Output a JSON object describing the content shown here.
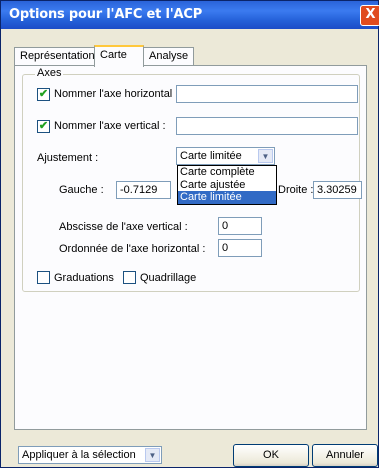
{
  "window": {
    "title": "Options pour l'AFC et l'ACP",
    "close_glyph": "X"
  },
  "tabs": [
    {
      "label": "Représentation",
      "active": false
    },
    {
      "label": "Carte",
      "active": true
    },
    {
      "label": "Analyse",
      "active": false
    }
  ],
  "axes": {
    "group_label": "Axes",
    "horizontal": {
      "checked": true,
      "label": "Nommer l'axe horizontal :",
      "value": ""
    },
    "vertical": {
      "checked": true,
      "label": "Nommer l'axe vertical :",
      "value": ""
    },
    "adjustment": {
      "label": "Ajustement :",
      "selected": "Carte limitée",
      "options": [
        "Carte complète",
        "Carte ajustée",
        "Carte limitée"
      ],
      "highlighted_option": "Carte limitée"
    },
    "left": {
      "label": "Gauche :",
      "value": "-0.7129"
    },
    "right": {
      "label": "Droite :",
      "value": "3.30259"
    },
    "vertical_axis_abscissa": {
      "label": "Abscisse de l'axe vertical :",
      "value": "0"
    },
    "horizontal_axis_ordinate": {
      "label": "Ordonnée de l'axe horizontal :",
      "value": "0"
    }
  },
  "options": {
    "graduations": {
      "checked": false,
      "label": "Graduations"
    },
    "gridlines": {
      "checked": false,
      "label": "Quadrillage"
    }
  },
  "footer": {
    "apply_select": "Appliquer à la sélection",
    "ok_label": "OK",
    "cancel_label": "Annuler"
  }
}
